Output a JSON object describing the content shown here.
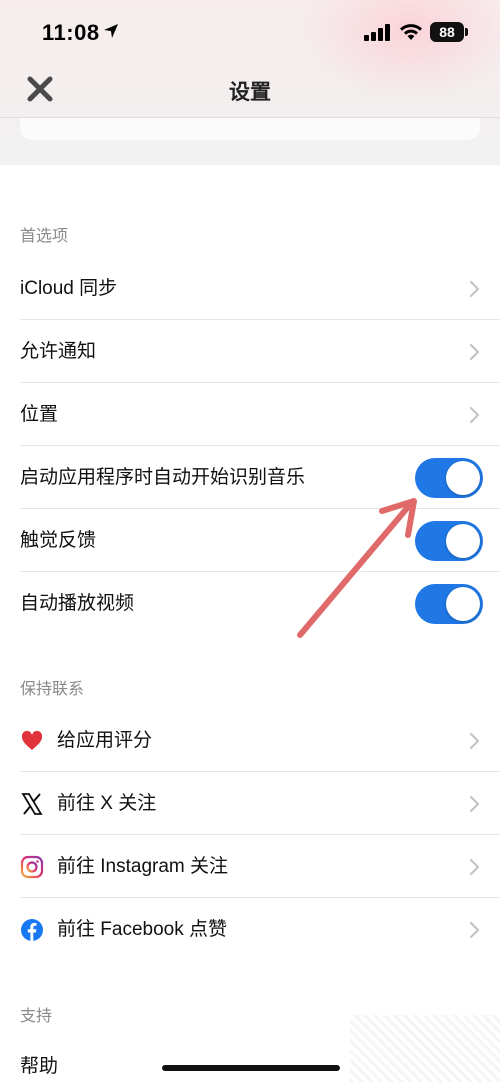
{
  "status_bar": {
    "time": "11:08",
    "battery": "88"
  },
  "nav": {
    "title": "设置"
  },
  "sections": {
    "preferences": {
      "header": "首选项",
      "items": [
        {
          "label": "iCloud 同步"
        },
        {
          "label": "允许通知"
        },
        {
          "label": "位置"
        },
        {
          "label": "启动应用程序时自动开始识别音乐",
          "toggle_on": true
        },
        {
          "label": "触觉反馈",
          "toggle_on": true
        },
        {
          "label": "自动播放视频",
          "toggle_on": true
        }
      ]
    },
    "stay_connected": {
      "header": "保持联系",
      "items": [
        {
          "label": "给应用评分",
          "icon": "heart-icon"
        },
        {
          "label": "前往 X 关注",
          "icon": "x-logo-icon"
        },
        {
          "label": "前往 Instagram 关注",
          "icon": "instagram-icon"
        },
        {
          "label": "前往 Facebook 点赞",
          "icon": "facebook-icon"
        }
      ]
    },
    "support": {
      "header": "支持",
      "items": [
        {
          "label": "帮助"
        }
      ]
    }
  },
  "colors": {
    "toggle_on": "#1f78e6",
    "annotation_arrow": "#e06a6a",
    "chevron": "#c4c4c7"
  }
}
